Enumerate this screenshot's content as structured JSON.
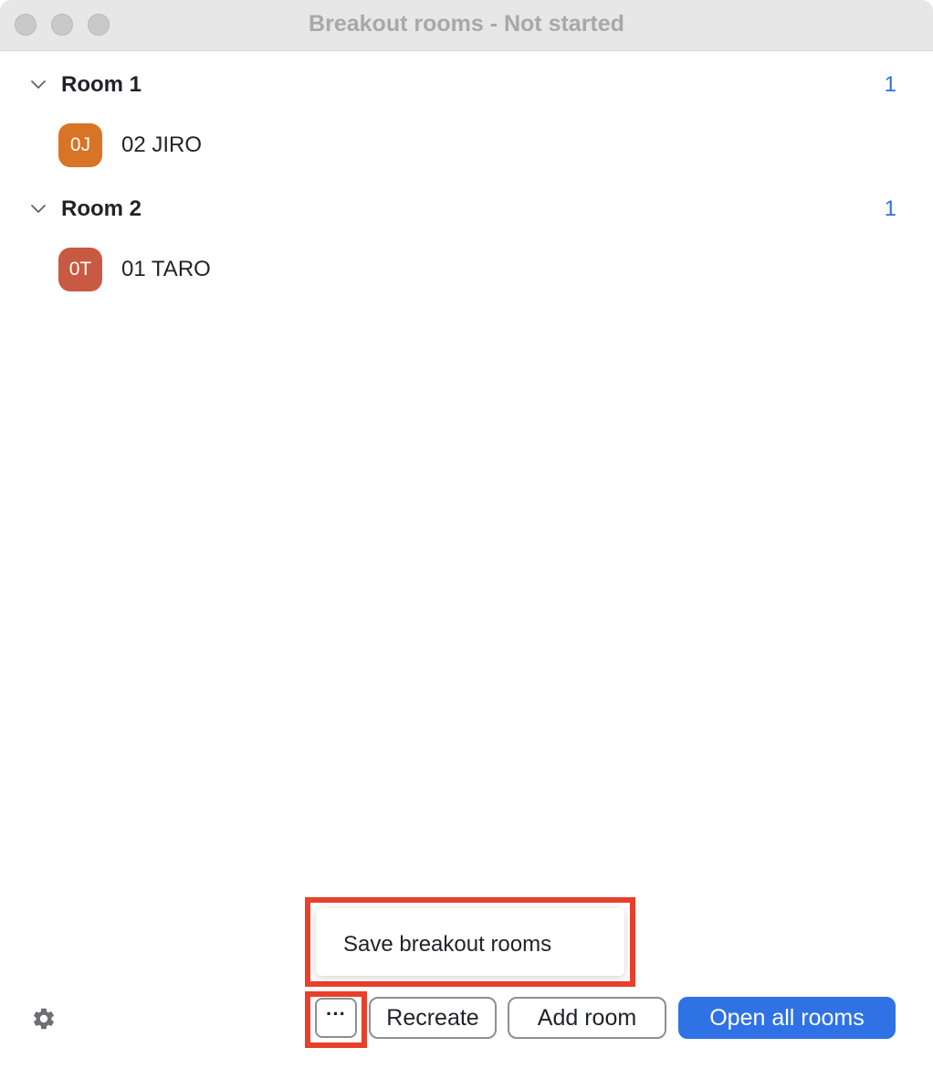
{
  "window": {
    "title": "Breakout rooms - Not started"
  },
  "rooms": [
    {
      "name": "Room 1",
      "count": "1",
      "participants": [
        {
          "initials": "0J",
          "name": "02 JIRO",
          "avatar_color": "#d97326"
        }
      ]
    },
    {
      "name": "Room 2",
      "count": "1",
      "participants": [
        {
          "initials": "0T",
          "name": "01 TARO",
          "avatar_color": "#c85a43"
        }
      ]
    }
  ],
  "popup_menu": {
    "items": [
      "Save breakout rooms"
    ]
  },
  "footer": {
    "settings_icon": "gear-icon",
    "more_label": "···",
    "recreate_label": "Recreate",
    "add_room_label": "Add room",
    "open_all_label": "Open all rooms"
  },
  "colors": {
    "accent": "#2e72e6",
    "highlight": "#e8402a",
    "count": "#2f6fde"
  }
}
